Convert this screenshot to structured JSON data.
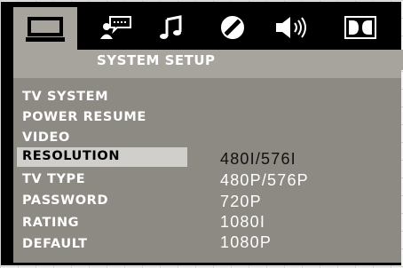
{
  "header": {
    "title": "SYSTEM SETUP"
  },
  "tabs": [
    {
      "icon": "tv-monitor-icon",
      "selected": true
    },
    {
      "icon": "speech-user-icon",
      "selected": false
    },
    {
      "icon": "music-note-icon",
      "selected": false
    },
    {
      "icon": "disc-icon",
      "selected": false
    },
    {
      "icon": "speaker-icon",
      "selected": false
    },
    {
      "icon": "dolby-icon",
      "selected": false
    }
  ],
  "menu": [
    {
      "label": "TV SYSTEM"
    },
    {
      "label": "POWER RESUME"
    },
    {
      "label": "VIDEO"
    },
    {
      "label": "RESOLUTION",
      "highlighted": true
    },
    {
      "label": "TV TYPE"
    },
    {
      "label": "PASSWORD"
    },
    {
      "label": "RATING"
    },
    {
      "label": "DEFAULT"
    }
  ],
  "options": [
    {
      "label": "480I/576I",
      "current": true
    },
    {
      "label": "480P/576P"
    },
    {
      "label": "720P"
    },
    {
      "label": "1080I"
    },
    {
      "label": "1080P"
    }
  ],
  "colors": {
    "osd_background": "#000000",
    "panel": "#8d8983",
    "selected_tab": "#a7a39d",
    "highlight": "#d1cfcb",
    "text": "#ffffff"
  }
}
